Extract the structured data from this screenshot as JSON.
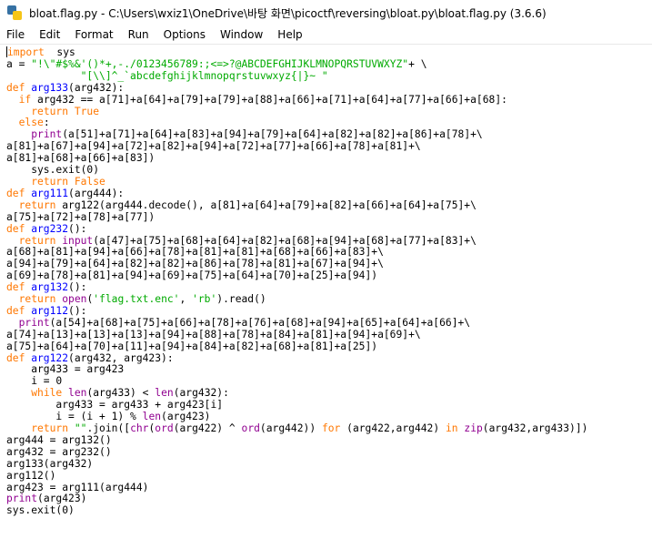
{
  "window": {
    "title": "bloat.flag.py - C:\\Users\\wxiz1\\OneDrive\\바탕 화면\\picoctf\\reversing\\bloat.py\\bloat.flag.py (3.6.6)"
  },
  "menu": [
    "File",
    "Edit",
    "Format",
    "Run",
    "Options",
    "Window",
    "Help"
  ],
  "colors": {
    "keyword": "#ff7700",
    "builtin": "#900090",
    "string": "#00aa00",
    "definition": "#0000ff"
  },
  "code_lines": [
    [
      [
        "kw",
        "import"
      ],
      [
        "",
        "  sys"
      ]
    ],
    [
      [
        "",
        "a = "
      ],
      [
        "st",
        "\"!\\\"#$%&'()*+,-./0123456789:;<=>?@ABCDEFGHIJKLMNOPQRSTUVWXYZ\""
      ],
      [
        "",
        "+ \\"
      ]
    ],
    [
      [
        "",
        "            "
      ],
      [
        "st",
        "\"[\\\\]^_`abcdefghijklmnopqrstuvwxyz{|}~ \""
      ]
    ],
    [
      [
        "kw",
        "def"
      ],
      [
        "",
        ""
      ],
      [
        "df",
        " arg133"
      ],
      [
        "",
        "(arg432):"
      ]
    ],
    [
      [
        "",
        "  "
      ],
      [
        "kw",
        "if"
      ],
      [
        "",
        " arg432 == a[71]+a[64]+a[79]+a[79]+a[88]+a[66]+a[71]+a[64]+a[77]+a[66]+a[68]:"
      ]
    ],
    [
      [
        "",
        "    "
      ],
      [
        "kw",
        "return"
      ],
      [
        "",
        ""
      ],
      [
        "kw",
        " True"
      ]
    ],
    [
      [
        "",
        "  "
      ],
      [
        "kw",
        "else"
      ],
      [
        "",
        ":"
      ]
    ],
    [
      [
        "",
        "    "
      ],
      [
        "bi",
        "print"
      ],
      [
        "",
        "(a[51]+a[71]+a[64]+a[83]+a[94]+a[79]+a[64]+a[82]+a[82]+a[86]+a[78]+\\"
      ]
    ],
    [
      [
        "",
        "a[81]+a[67]+a[94]+a[72]+a[82]+a[94]+a[72]+a[77]+a[66]+a[78]+a[81]+\\"
      ]
    ],
    [
      [
        "",
        "a[81]+a[68]+a[66]+a[83])"
      ]
    ],
    [
      [
        "",
        "    sys.exit(0)"
      ]
    ],
    [
      [
        "",
        "    "
      ],
      [
        "kw",
        "return"
      ],
      [
        "",
        ""
      ],
      [
        "kw",
        " False"
      ]
    ],
    [
      [
        "kw",
        "def"
      ],
      [
        "df",
        " arg111"
      ],
      [
        "",
        "(arg444):"
      ]
    ],
    [
      [
        "",
        "  "
      ],
      [
        "kw",
        "return"
      ],
      [
        "",
        " arg122(arg444.decode(), a[81]+a[64]+a[79]+a[82]+a[66]+a[64]+a[75]+\\"
      ]
    ],
    [
      [
        "",
        "a[75]+a[72]+a[78]+a[77])"
      ]
    ],
    [
      [
        "kw",
        "def"
      ],
      [
        "df",
        " arg232"
      ],
      [
        "",
        "():"
      ]
    ],
    [
      [
        "",
        "  "
      ],
      [
        "kw",
        "return"
      ],
      [
        "",
        ""
      ],
      [
        "bi",
        " input"
      ],
      [
        "",
        "(a[47]+a[75]+a[68]+a[64]+a[82]+a[68]+a[94]+a[68]+a[77]+a[83]+\\"
      ]
    ],
    [
      [
        "",
        "a[68]+a[81]+a[94]+a[66]+a[78]+a[81]+a[81]+a[68]+a[66]+a[83]+\\"
      ]
    ],
    [
      [
        "",
        "a[94]+a[79]+a[64]+a[82]+a[82]+a[86]+a[78]+a[81]+a[67]+a[94]+\\"
      ]
    ],
    [
      [
        "",
        "a[69]+a[78]+a[81]+a[94]+a[69]+a[75]+a[64]+a[70]+a[25]+a[94])"
      ]
    ],
    [
      [
        "kw",
        "def"
      ],
      [
        "df",
        " arg132"
      ],
      [
        "",
        "():"
      ]
    ],
    [
      [
        "",
        "  "
      ],
      [
        "kw",
        "return"
      ],
      [
        "",
        ""
      ],
      [
        "bi",
        " open"
      ],
      [
        "",
        "("
      ],
      [
        "st",
        "'flag.txt.enc'"
      ],
      [
        "",
        ", "
      ],
      [
        "st",
        "'rb'"
      ],
      [
        "",
        ").read()"
      ]
    ],
    [
      [
        "kw",
        "def"
      ],
      [
        "df",
        " arg112"
      ],
      [
        "",
        "():"
      ]
    ],
    [
      [
        "",
        "  "
      ],
      [
        "bi",
        "print"
      ],
      [
        "",
        "(a[54]+a[68]+a[75]+a[66]+a[78]+a[76]+a[68]+a[94]+a[65]+a[64]+a[66]+\\"
      ]
    ],
    [
      [
        "",
        "a[74]+a[13]+a[13]+a[13]+a[94]+a[88]+a[78]+a[84]+a[81]+a[94]+a[69]+\\"
      ]
    ],
    [
      [
        "",
        "a[75]+a[64]+a[70]+a[11]+a[94]+a[84]+a[82]+a[68]+a[81]+a[25])"
      ]
    ],
    [
      [
        "kw",
        "def"
      ],
      [
        "df",
        " arg122"
      ],
      [
        "",
        "(arg432, arg423):"
      ]
    ],
    [
      [
        "",
        "    arg433 = arg423"
      ]
    ],
    [
      [
        "",
        "    i = 0"
      ]
    ],
    [
      [
        "",
        "    "
      ],
      [
        "kw",
        "while"
      ],
      [
        "",
        ""
      ],
      [
        "bi",
        " len"
      ],
      [
        "",
        "(arg433) < "
      ],
      [
        "bi",
        "len"
      ],
      [
        "",
        "(arg432):"
      ]
    ],
    [
      [
        "",
        "        arg433 = arg433 + arg423[i]"
      ]
    ],
    [
      [
        "",
        "        i = (i + 1) % "
      ],
      [
        "bi",
        "len"
      ],
      [
        "",
        "(arg423)"
      ]
    ],
    [
      [
        "",
        "    "
      ],
      [
        "kw",
        "return"
      ],
      [
        "",
        " "
      ],
      [
        "st",
        "\"\""
      ],
      [
        "",
        ".join(["
      ],
      [
        "bi",
        "chr"
      ],
      [
        "",
        "("
      ],
      [
        "bi",
        "ord"
      ],
      [
        "",
        "(arg422) ^ "
      ],
      [
        "bi",
        "ord"
      ],
      [
        "",
        "(arg442)) "
      ],
      [
        "kw",
        "for"
      ],
      [
        "",
        " (arg422,arg442) "
      ],
      [
        "kw",
        "in"
      ],
      [
        "",
        " "
      ],
      [
        "bi",
        "zip"
      ],
      [
        "",
        "(arg432,arg433)])"
      ]
    ],
    [
      [
        "",
        "arg444 = arg132()"
      ]
    ],
    [
      [
        "",
        "arg432 = arg232()"
      ]
    ],
    [
      [
        "",
        "arg133(arg432)"
      ]
    ],
    [
      [
        "",
        "arg112()"
      ]
    ],
    [
      [
        "",
        "arg423 = arg111(arg444)"
      ]
    ],
    [
      [
        "bi",
        "print"
      ],
      [
        "",
        "(arg423)"
      ]
    ],
    [
      [
        "",
        "sys.exit(0)"
      ]
    ]
  ]
}
